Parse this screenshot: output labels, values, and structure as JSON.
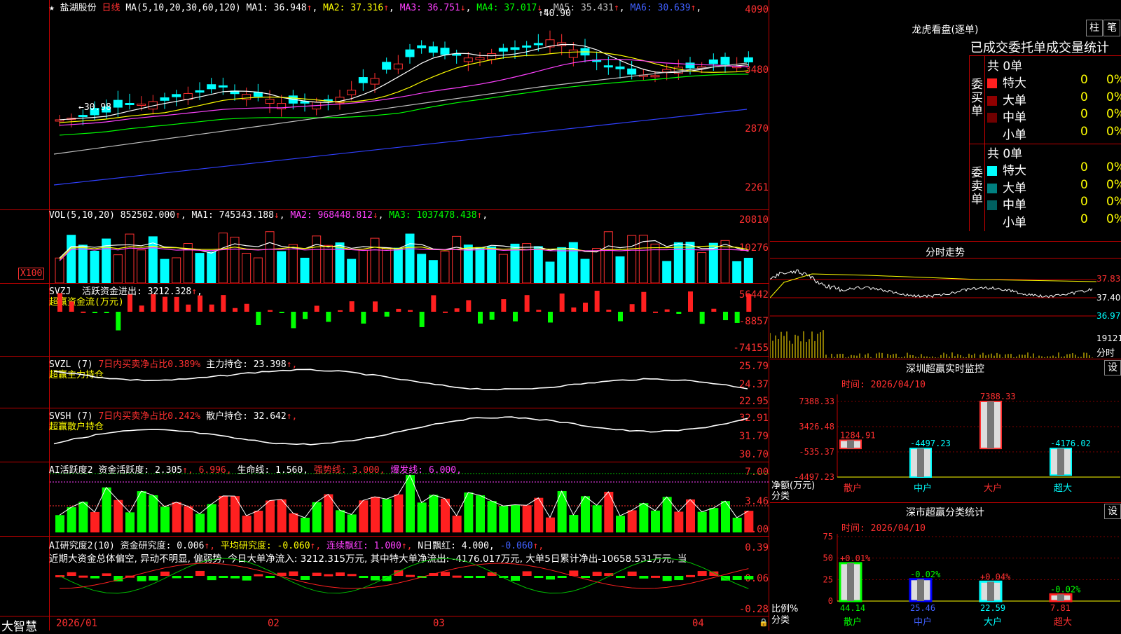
{
  "header": {
    "star": "★",
    "stock_name": "盐湖股份",
    "period": "日线",
    "ma_label": "MA(5,10,20,30,60,120)",
    "ma": [
      {
        "label": "MA1:",
        "value": "36.948",
        "arrow": "↑",
        "color": "#ffffff"
      },
      {
        "label": "MA2:",
        "value": "37.316",
        "arrow": "↑",
        "color": "#ffff00"
      },
      {
        "label": "MA3:",
        "value": "36.751",
        "arrow": "↓",
        "color": "#ff40ff"
      },
      {
        "label": "MA4:",
        "value": "37.017",
        "arrow": "↓",
        "color": "#00ff00"
      },
      {
        "label": "MA5:",
        "value": "35.431",
        "arrow": "↑",
        "color": "#c0c0c0"
      },
      {
        "label": "MA6:",
        "value": "30.639",
        "arrow": "↑",
        "color": "#4060ff"
      }
    ],
    "high_mark": "40.90",
    "low_mark": "30.98"
  },
  "price_axis": [
    "4090",
    "3480",
    "2870",
    "2261"
  ],
  "vol": {
    "label": "VOL(5,10,20)",
    "value": "852502.000",
    "arrow": "↑",
    "ma": [
      {
        "text": "MA1: 745343.188",
        "arrow": "↓",
        "color": "#ffffff"
      },
      {
        "text": "MA2: 968448.812",
        "arrow": "↓",
        "color": "#ff40ff"
      },
      {
        "text": "MA3: 1037478.438",
        "arrow": "↑",
        "color": "#00ff00"
      }
    ],
    "axis": [
      "20810",
      "10276"
    ],
    "unit": "X100"
  },
  "svzj": {
    "label": "SVZJ",
    "text": "活跃资金进出: 3212.328",
    "arrow": "↑",
    "sub": "超赢资金流(万元)",
    "axis": [
      "56442",
      "-8857",
      "-74155"
    ]
  },
  "svzl": {
    "label": "SVZL (7)",
    "text1": "7日内买卖净占比0.389%",
    "text2": "主力持仓: 23.398",
    "arrow": "↑,",
    "sub": "超赢主力持仓",
    "axis": [
      "25.79",
      "24.37",
      "22.95"
    ]
  },
  "svsh": {
    "label": "SVSH (7)",
    "text1": "7日内买卖净占比0.242%",
    "text2": "散户持仓: 32.642",
    "arrow": "↑,",
    "sub": "超赢散户持仓",
    "axis": [
      "32.91",
      "31.79",
      "30.70"
    ]
  },
  "ai1": {
    "label": "AI活跃度2",
    "t1": "资金活跃度: 2.305",
    "t2": "↑, 6.996,",
    "t3": "生命线: 1.560,",
    "t4": "强势线: 3.000,",
    "t5": "爆发线: 6.000,",
    "axis": [
      "7.00",
      "3.46",
      "0.00"
    ]
  },
  "ai2": {
    "label": "AI研究度2(10)",
    "t1": "资金研究度: 0.006",
    "a1": "↑,",
    "t2": "平均研究度: -0.060",
    "a2": "↑,",
    "t3": "连续飘红: 1.000",
    "a3": "↑,",
    "t4": "N日飘红: 4.000,",
    "t5": "-0.060",
    "a5": "↑,",
    "desc": "近期大资金总体偏空, 异动不明显, 偏弱势, 今日大单净流入: 3212.315万元, 其中特大单净流出: -4176.017万元, 大单5日累计净出-10658.531万元, 当",
    "axis": [
      "0.39",
      "0.06",
      "-0.28"
    ]
  },
  "footer": {
    "brand": "大智慧",
    "dates": [
      "2026/01",
      "02",
      "03",
      "04"
    ]
  },
  "right": {
    "dragon_title": "龙虎看盘(逐单)",
    "btn_zhu": "柱",
    "btn_bi": "笔",
    "tabs_title": "已成交委托单成交量统计",
    "buy_group": {
      "side_label": "委买单",
      "total": "共 0单",
      "rows": [
        {
          "name": "特大",
          "val": "0",
          "pct": "0%",
          "color": "#ff2020"
        },
        {
          "name": "大单",
          "val": "0",
          "pct": "0%",
          "color": "#900000"
        },
        {
          "name": "中单",
          "val": "0",
          "pct": "0%",
          "color": "#700000"
        },
        {
          "name": "小单",
          "val": "0",
          "pct": "0%",
          "color": "#000000"
        }
      ]
    },
    "sell_group": {
      "side_label": "委卖单",
      "total": "共 0单",
      "rows": [
        {
          "name": "特大",
          "val": "0",
          "pct": "0%",
          "color": "#00ffff"
        },
        {
          "name": "大单",
          "val": "0",
          "pct": "0%",
          "color": "#008080"
        },
        {
          "name": "中单",
          "val": "0",
          "pct": "0%",
          "color": "#006060"
        },
        {
          "name": "小单",
          "val": "0",
          "pct": "0%",
          "color": "#000000"
        }
      ]
    },
    "intraday_title": "分时走势",
    "intraday_axis": [
      "37.83",
      "37.40",
      "36.97"
    ],
    "intraday_vol": "19121",
    "intraday_unit": "分时",
    "sz_title": "深圳超赢实时监控",
    "set_btn": "设",
    "time_label": "时间: 2026/04/10",
    "sz_axis": [
      "7388.33",
      "3426.48",
      "-535.37",
      "-4497.23"
    ],
    "sz_ylabel": "净额(万元)",
    "sz_xlabel": "分类",
    "sz_bars": [
      {
        "name": "散户",
        "value": 1284.91,
        "label": "1284.91"
      },
      {
        "name": "中户",
        "value": -4497.23,
        "label": "-4497.23"
      },
      {
        "name": "大户",
        "value": 7388.33,
        "label": "7388.33"
      },
      {
        "name": "超大",
        "value": -4176.02,
        "label": "-4176.02"
      }
    ],
    "sc_title": "深市超赢分类统计",
    "sc_axis": [
      "75",
      "50",
      "25",
      "0"
    ],
    "sc_ylabel": "比例%",
    "sc_xlabel": "分类",
    "sc_bars": [
      {
        "name": "散户",
        "value": 44.14,
        "label": "44.14",
        "delta": "+0.01%"
      },
      {
        "name": "中户",
        "value": 25.46,
        "label": "25.46",
        "delta": "-0.02%"
      },
      {
        "name": "大户",
        "value": 22.59,
        "label": "22.59",
        "delta": "+0.04%"
      },
      {
        "name": "超大",
        "value": 7.81,
        "label": "7.81",
        "delta": "-0.02%"
      }
    ]
  }
}
